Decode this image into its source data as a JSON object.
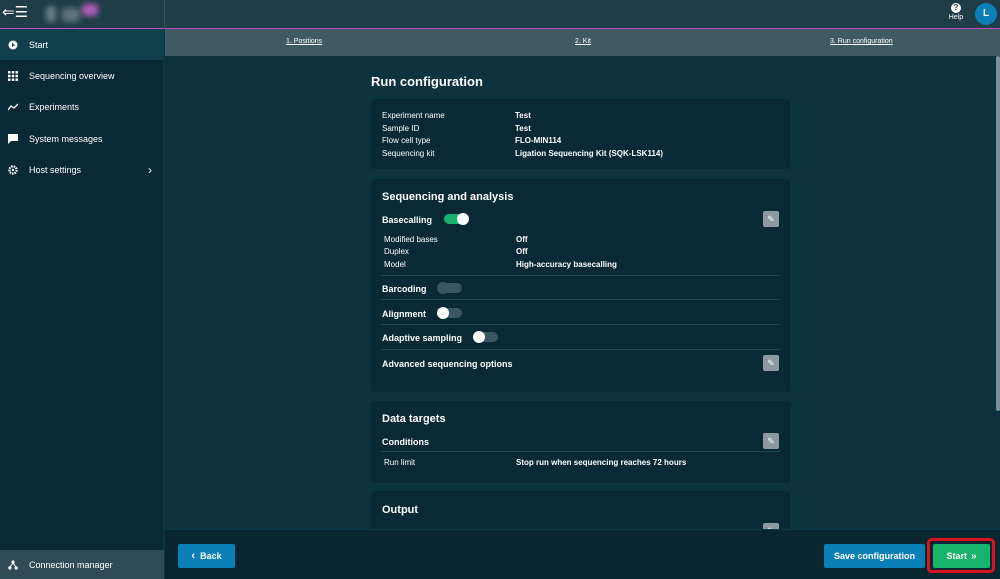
{
  "topbar": {
    "menu_icon": "menu-collapse-icon",
    "help_label": "Help",
    "help_icon": "question-circle-icon",
    "avatar_initial": "L"
  },
  "sidebar": {
    "items": [
      {
        "label": "Start",
        "icon": "play-circle-icon",
        "active": true
      },
      {
        "label": "Sequencing overview",
        "icon": "grid-icon"
      },
      {
        "label": "Experiments",
        "icon": "chart-line-icon"
      },
      {
        "label": "System messages",
        "icon": "message-icon"
      },
      {
        "label": "Host settings",
        "icon": "gear-icon",
        "has_chevron": true
      }
    ],
    "connection_manager": "Connection manager"
  },
  "stepper": {
    "steps": [
      "1. Positions",
      "2. Kit",
      "3. Run configuration"
    ]
  },
  "page_title": "Run configuration",
  "summary": {
    "rows": [
      {
        "label": "Experiment name",
        "value": "Test"
      },
      {
        "label": "Sample ID",
        "value": "Test"
      },
      {
        "label": "Flow cell type",
        "value": "FLO-MIN114"
      },
      {
        "label": "Sequencing kit",
        "value": "Ligation Sequencing Kit (SQK-LSK114)"
      }
    ]
  },
  "sequencing": {
    "heading": "Sequencing and analysis",
    "basecalling_label": "Basecalling",
    "basecalling_on": true,
    "basecalling_rows": [
      {
        "label": "Modified bases",
        "value": "Off"
      },
      {
        "label": "Duplex",
        "value": "Off"
      },
      {
        "label": "Model",
        "value": "High-accuracy basecalling"
      }
    ],
    "barcoding_label": "Barcoding",
    "alignment_label": "Alignment",
    "adaptive_label": "Adaptive sampling",
    "advanced_label": "Advanced sequencing options"
  },
  "data_targets": {
    "heading": "Data targets",
    "conditions_label": "Conditions",
    "run_limit_label": "Run limit",
    "run_limit_value": "Stop run when sequencing reaches 72 hours"
  },
  "output": {
    "heading": "Output"
  },
  "footer": {
    "back_label": "Back",
    "save_label": "Save configuration",
    "start_label": "Start"
  },
  "colors": {
    "accent_blue": "#0a7fb8",
    "start_green": "#17b36a",
    "highlight_red": "#d9141e"
  }
}
